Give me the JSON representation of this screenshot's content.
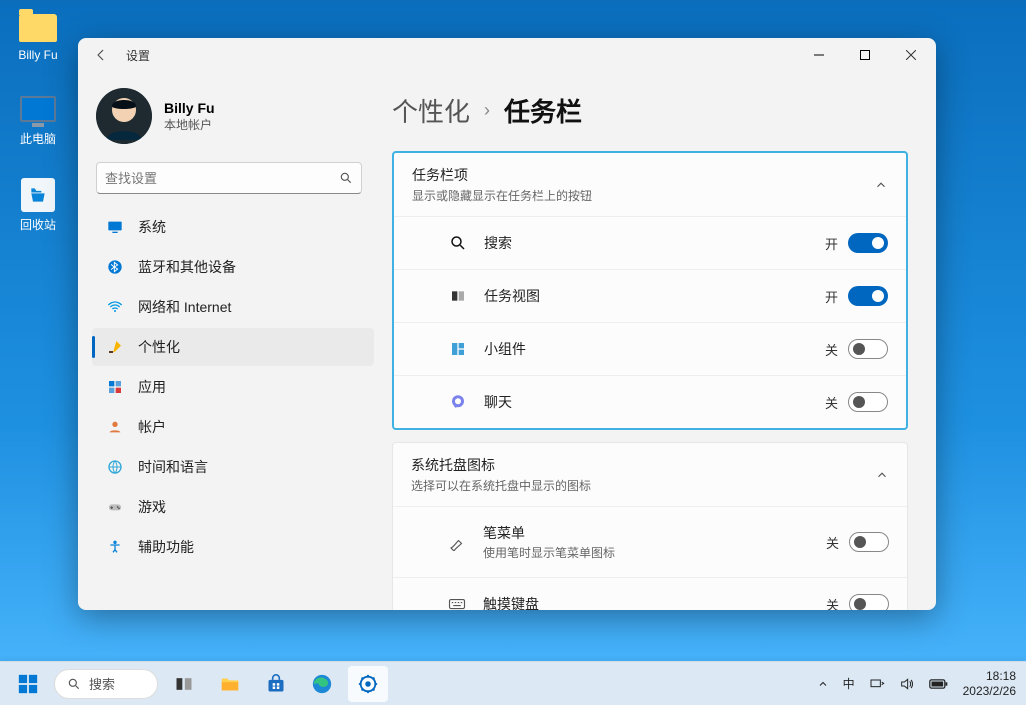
{
  "desktop": {
    "icons": [
      {
        "label": "Billy Fu"
      },
      {
        "label": "此电脑"
      },
      {
        "label": "回收站"
      }
    ]
  },
  "window": {
    "title": "设置",
    "user": {
      "name": "Billy Fu",
      "subtitle": "本地帐户"
    },
    "search_placeholder": "查找设置",
    "nav": {
      "items": [
        {
          "label": "系统"
        },
        {
          "label": "蓝牙和其他设备"
        },
        {
          "label": "网络和 Internet"
        },
        {
          "label": "个性化"
        },
        {
          "label": "应用"
        },
        {
          "label": "帐户"
        },
        {
          "label": "时间和语言"
        },
        {
          "label": "游戏"
        },
        {
          "label": "辅助功能"
        }
      ],
      "active_index": 3
    },
    "breadcrumb": {
      "parent": "个性化",
      "current": "任务栏"
    },
    "group1": {
      "title": "任务栏项",
      "subtitle": "显示或隐藏显示在任务栏上的按钮",
      "rows": [
        {
          "label": "搜索",
          "state": "开",
          "on": true
        },
        {
          "label": "任务视图",
          "state": "开",
          "on": true
        },
        {
          "label": "小组件",
          "state": "关",
          "on": false
        },
        {
          "label": "聊天",
          "state": "关",
          "on": false
        }
      ]
    },
    "group2": {
      "title": "系统托盘图标",
      "subtitle": "选择可以在系统托盘中显示的图标",
      "rows": [
        {
          "label": "笔菜单",
          "sub": "使用笔时显示笔菜单图标",
          "state": "关",
          "on": false
        },
        {
          "label": "触摸键盘",
          "sub": "",
          "state": "关",
          "on": false
        }
      ]
    }
  },
  "taskbar": {
    "search_label": "搜索",
    "tray": {
      "ime": "中",
      "time": "18:18",
      "date": "2023/2/26"
    }
  }
}
